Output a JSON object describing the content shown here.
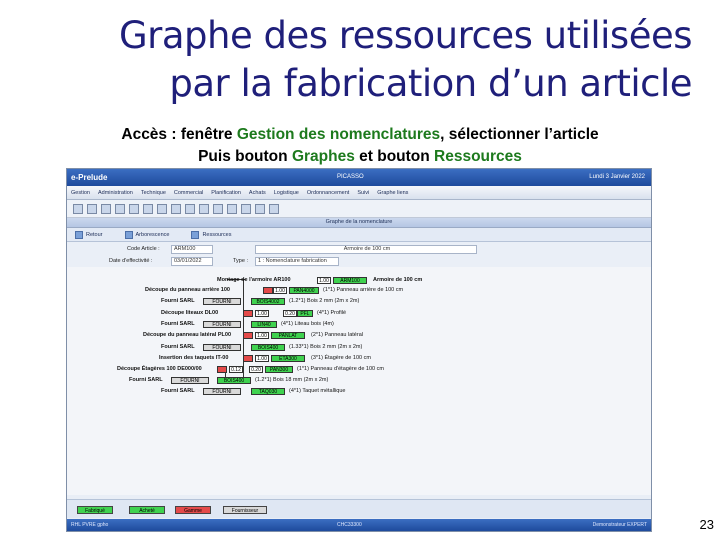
{
  "slide": {
    "title_line1": "Graphe des ressources utilisées",
    "title_line2": "par la fabrication d’un article",
    "sub1_a": "Accès : fenêtre ",
    "sub1_b": "Gestion des nomenclatures",
    "sub1_c": ", sélectionner l’article",
    "sub2_a": "Puis bouton ",
    "sub2_b": "Graphes",
    "sub2_c": " et bouton ",
    "sub2_d": "Ressources",
    "page_number": "23"
  },
  "app": {
    "name": "e-Prelude",
    "user": "PICASSO",
    "date": "Lundi 3 Janvier 2022",
    "menu": [
      "Gestion",
      "Administration",
      "Technique",
      "Commercial",
      "Planification",
      "Achats",
      "Logistique",
      "Ordonnancement",
      "Suivi",
      "Graphe liens"
    ],
    "section_title": "Graphe de la nomenclature",
    "tabs": [
      "Retour",
      "Arborescence",
      "Ressources"
    ],
    "form": {
      "code_label": "Code Article :",
      "code_value": "ARM100",
      "code_desc": "Armoire de 100 cm",
      "date_label": "Date d'effectivité :",
      "date_value": "03/01/2022",
      "type_label": "Type :",
      "type_value": "1 : Nomenclature fabrication"
    },
    "graph": {
      "rows": [
        {
          "left": "Montage de l'armoire AR100",
          "qty": "1.00",
          "code": "ARM100",
          "right": "Armoire de 100 cm"
        },
        {
          "left": "Découpe du panneau arrière 100",
          "qty": "1.00",
          "code": "PAN4000",
          "right": "(1*1) Panneau arrière de 100 cm"
        },
        {
          "left": "Fourni SARL",
          "code2": "FOURNI",
          "code": "BOIS4002",
          "right": "(1.2*1) Bois 2 mm (2m x 2m)"
        },
        {
          "left": "Découpe liteaux DL00",
          "qty": "1.00",
          "qty2": "0.20",
          "code": "PFL",
          "right": "(4*1) Profilé"
        },
        {
          "left": "Fourni SARL",
          "code2": "FOURNI",
          "code": "LIN40",
          "right": "(4*1) Liteau bois (4m)"
        },
        {
          "left": "Découpe du panneau latéral PL00",
          "qty": "1.00",
          "code": "PANLAT",
          "right": "(2*1) Panneau latéral"
        },
        {
          "left": "Fourni SARL",
          "code2": "FOURNI",
          "code": "BOIS400",
          "right": "(1.33*1) Bois 2 mm (2m x 2m)"
        },
        {
          "left": "Insertion des taquets IT-00",
          "qty": "1.00",
          "code": "ETA300",
          "right": "(3*1) Étagère de 100 cm"
        },
        {
          "left": "Découpe Étagères 100 DE000/00",
          "qty": "0.12",
          "qty2": "0.20",
          "code": "PAN300",
          "right": "(1*1) Panneau d'étagère de 100 cm"
        },
        {
          "left": "Fourni SARL",
          "code2": "FOURNI",
          "code": "BOIS400",
          "right": "(1.2*1) Bois 18 mm (2m x 2m)"
        },
        {
          "left": "Fourni SARL",
          "code2": "FOURNI",
          "code": "TAQ030",
          "right": "(4*1) Taquet métallique"
        }
      ]
    },
    "legend": [
      "Fabriqué",
      "Acheté",
      "Gamme",
      "Fournisseur"
    ],
    "status": {
      "left": "RHL   PVRE   gpho",
      "mid": "CHC33300",
      "right": "Demonstrateur EXPERT"
    },
    "colors": {
      "fabrique": "#3fd24f",
      "achete": "#3fd24f",
      "gamme": "#e44a4a",
      "fournisseur": "#d9d9d9"
    }
  }
}
